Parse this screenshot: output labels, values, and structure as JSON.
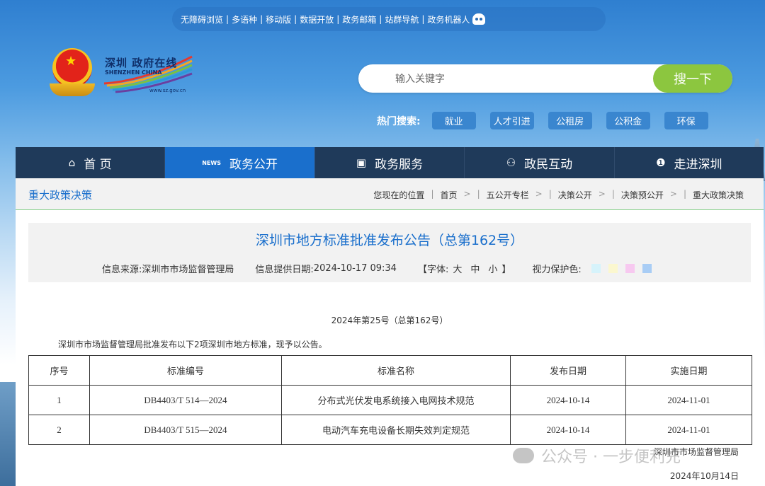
{
  "topbar": {
    "links": [
      "无障碍浏览",
      "多语种",
      "移动版",
      "数据开放",
      "政务邮箱",
      "站群导航",
      "政务机器人"
    ]
  },
  "logo": {
    "cn": "深圳 政府在线",
    "en": "SHENZHEN CHINA",
    "url": "www.sz.gov.cn"
  },
  "search": {
    "placeholder": "输入关键字",
    "button": "搜一下"
  },
  "hot": {
    "label": "热门搜索:",
    "tags": [
      "就业",
      "人才引进",
      "公租房",
      "公积金",
      "环保"
    ]
  },
  "nav": [
    {
      "label": "首 页",
      "icon": "home-icon",
      "glyph": "⌂"
    },
    {
      "label": "政务公开",
      "icon": "news-icon",
      "glyph": "NEWS"
    },
    {
      "label": "政务服务",
      "icon": "monitor-icon",
      "glyph": "▣"
    },
    {
      "label": "政民互动",
      "icon": "people-icon",
      "glyph": "⚇"
    },
    {
      "label": "走进深圳",
      "icon": "info-icon",
      "glyph": "❶"
    }
  ],
  "section": "重大政策决策",
  "breadcrumb": {
    "label": "您现在的位置",
    "items": [
      "首页",
      "五公开专栏",
      "决策公开",
      "决策预公开",
      "重大政策决策"
    ]
  },
  "article": {
    "title": "深圳市地方标准批准发布公告（总第162号）",
    "source_label": "信息来源:",
    "source": "深圳市市场监督管理局",
    "date_label": "信息提供日期:",
    "date": "2024-10-17 09:34",
    "font_label": "【字体:",
    "font_sizes": [
      "大",
      "中",
      "小"
    ],
    "font_close": "】",
    "eye_label": "视力保护色:",
    "eye_colors": [
      "#d6f3fb",
      "#fbf7cf",
      "#f7c9f0",
      "#a9cdf5"
    ],
    "doc_number": "2024年第25号（总第162号）",
    "intro": "深圳市市场监督管理局批准发布以下2项深圳市地方标准，现予以公告。",
    "table": {
      "headers": [
        "序号",
        "标准编号",
        "标准名称",
        "发布日期",
        "实施日期"
      ],
      "rows": [
        [
          "1",
          "DB4403/T 514—2024",
          "分布式光伏发电系统接入电网技术规范",
          "2024-10-14",
          "2024-11-01"
        ],
        [
          "2",
          "DB4403/T 515—2024",
          "电动汽车充电设备长期失效判定规范",
          "2024-10-14",
          "2024-11-01"
        ]
      ]
    },
    "sign_org": "深圳市市场监督管理局",
    "sign_date": "2024年10月14日"
  },
  "watermark": "公众号 · 一步便利充"
}
